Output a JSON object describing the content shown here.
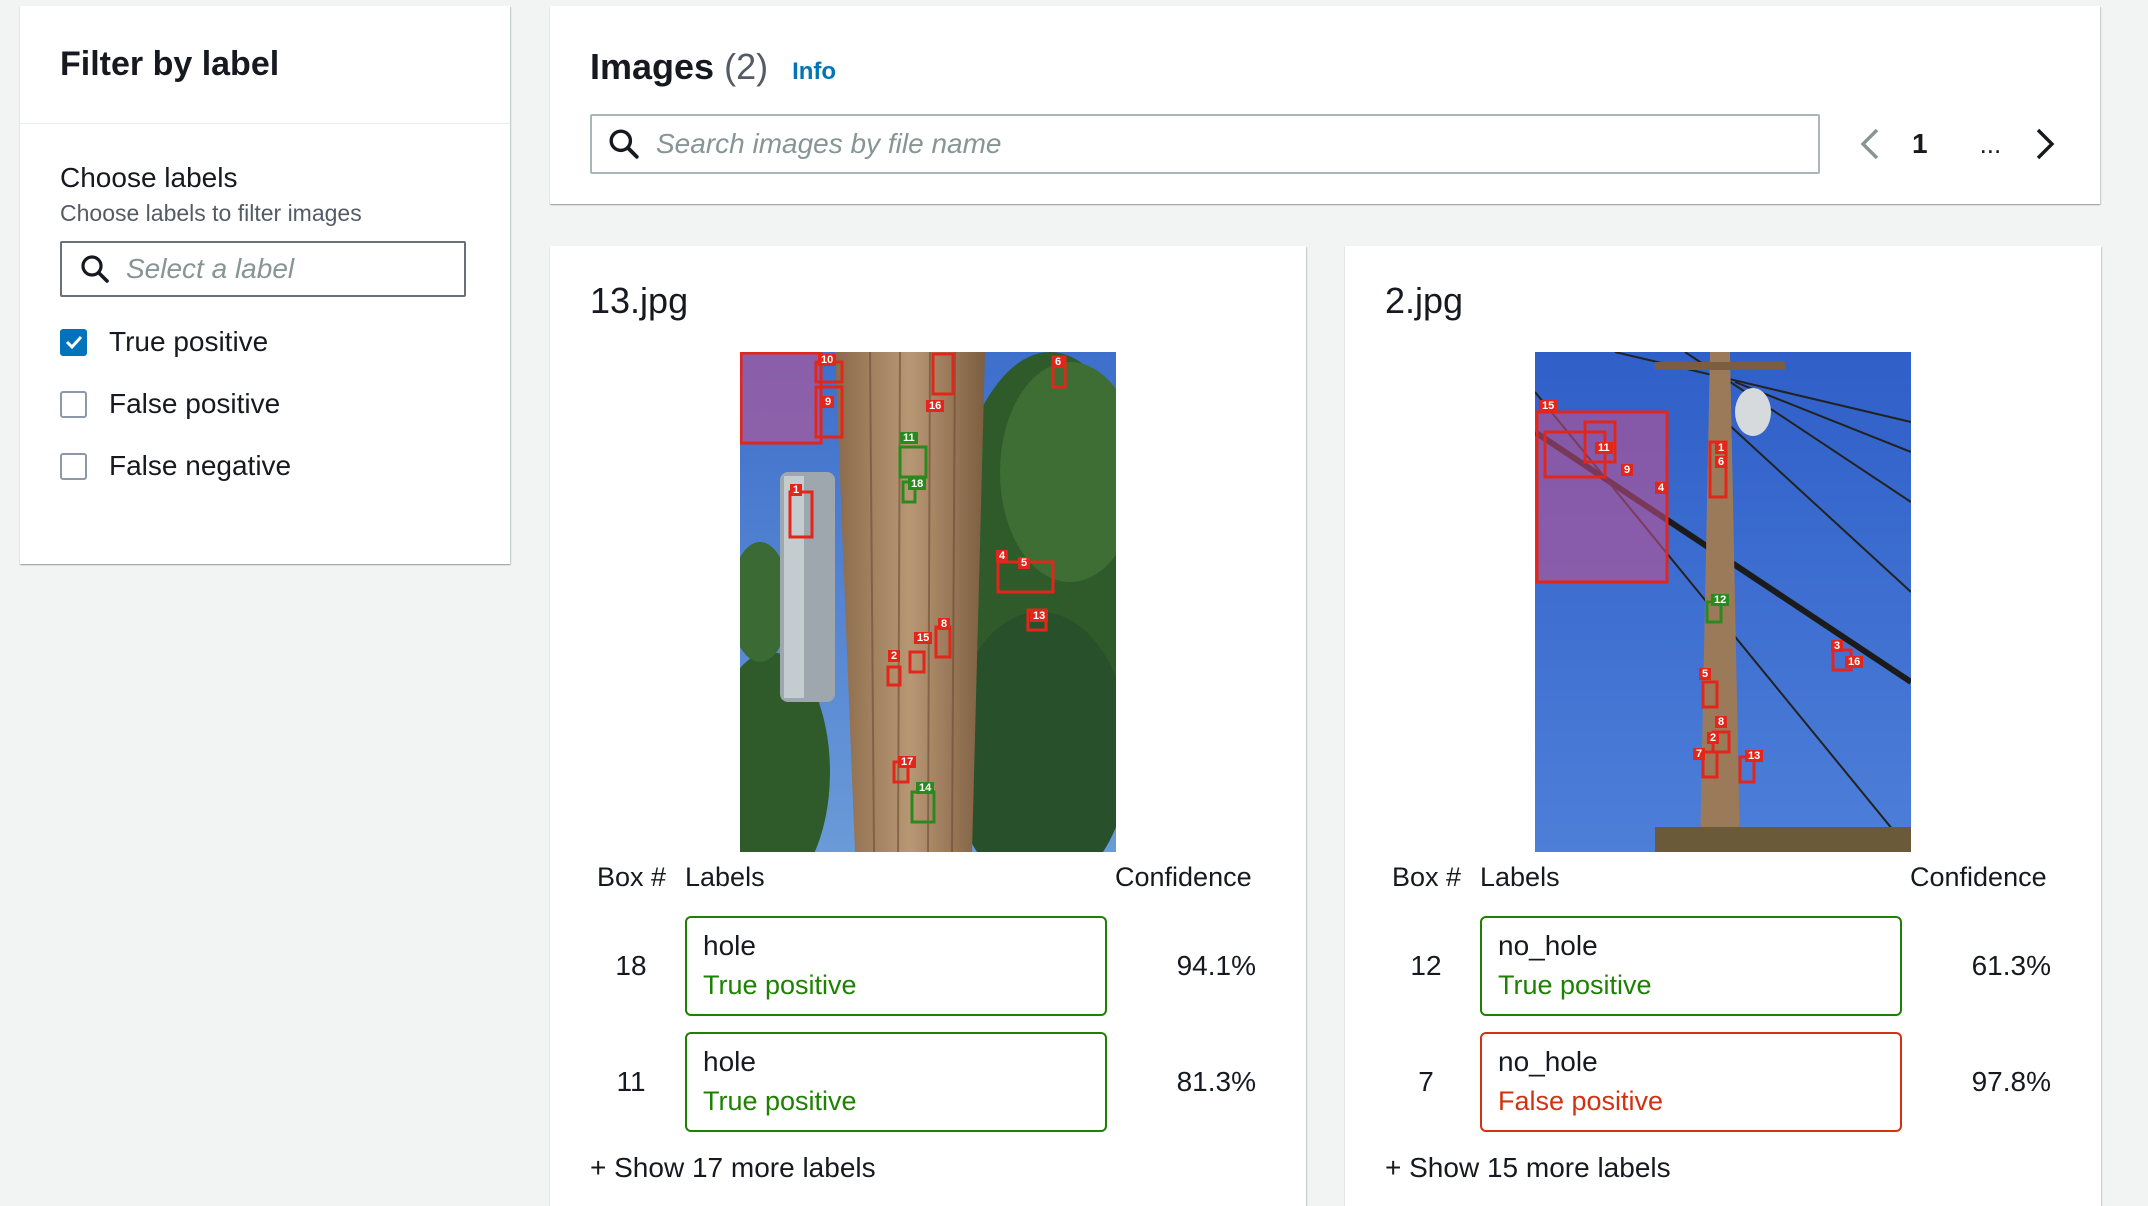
{
  "filter": {
    "title": "Filter by label",
    "choose_label": "Choose labels",
    "choose_desc": "Choose labels to filter images",
    "select_placeholder": "Select a label",
    "options": [
      {
        "label": "True positive",
        "checked": true
      },
      {
        "label": "False positive",
        "checked": false
      },
      {
        "label": "False negative",
        "checked": false
      }
    ]
  },
  "images": {
    "title": "Images",
    "count": "(2)",
    "info": "Info",
    "search_placeholder": "Search images by file name",
    "pager": {
      "page": "1",
      "ellipsis": "..."
    }
  },
  "table_headers": {
    "box": "Box #",
    "labels": "Labels",
    "confidence": "Confidence"
  },
  "cards": [
    {
      "filename": "13.jpg",
      "rows": [
        {
          "box": "18",
          "label": "hole",
          "status": "True positive",
          "confidence": "94.1%"
        },
        {
          "box": "11",
          "label": "hole",
          "status": "True positive",
          "confidence": "81.3%"
        }
      ],
      "show_more": "+ Show 17 more labels",
      "boxes": [
        "10",
        "9",
        "16",
        "6",
        "1",
        "11",
        "18",
        "4",
        "5",
        "13",
        "8",
        "15",
        "2",
        "17",
        "14"
      ]
    },
    {
      "filename": "2.jpg",
      "rows": [
        {
          "box": "12",
          "label": "no_hole",
          "status": "True positive",
          "confidence": "61.3%"
        },
        {
          "box": "7",
          "label": "no_hole",
          "status": "False positive",
          "confidence": "97.8%"
        }
      ],
      "show_more": "+ Show 15 more labels",
      "boxes": [
        "15",
        "11",
        "9",
        "4",
        "1",
        "6",
        "12",
        "3",
        "16",
        "5",
        "8",
        "2",
        "7",
        "13"
      ]
    }
  ],
  "colors": {
    "accent": "#0073bb",
    "tp": "#1d8102",
    "fp": "#d13212",
    "box_red": "#e3261b",
    "box_green": "#2b8a1e"
  }
}
